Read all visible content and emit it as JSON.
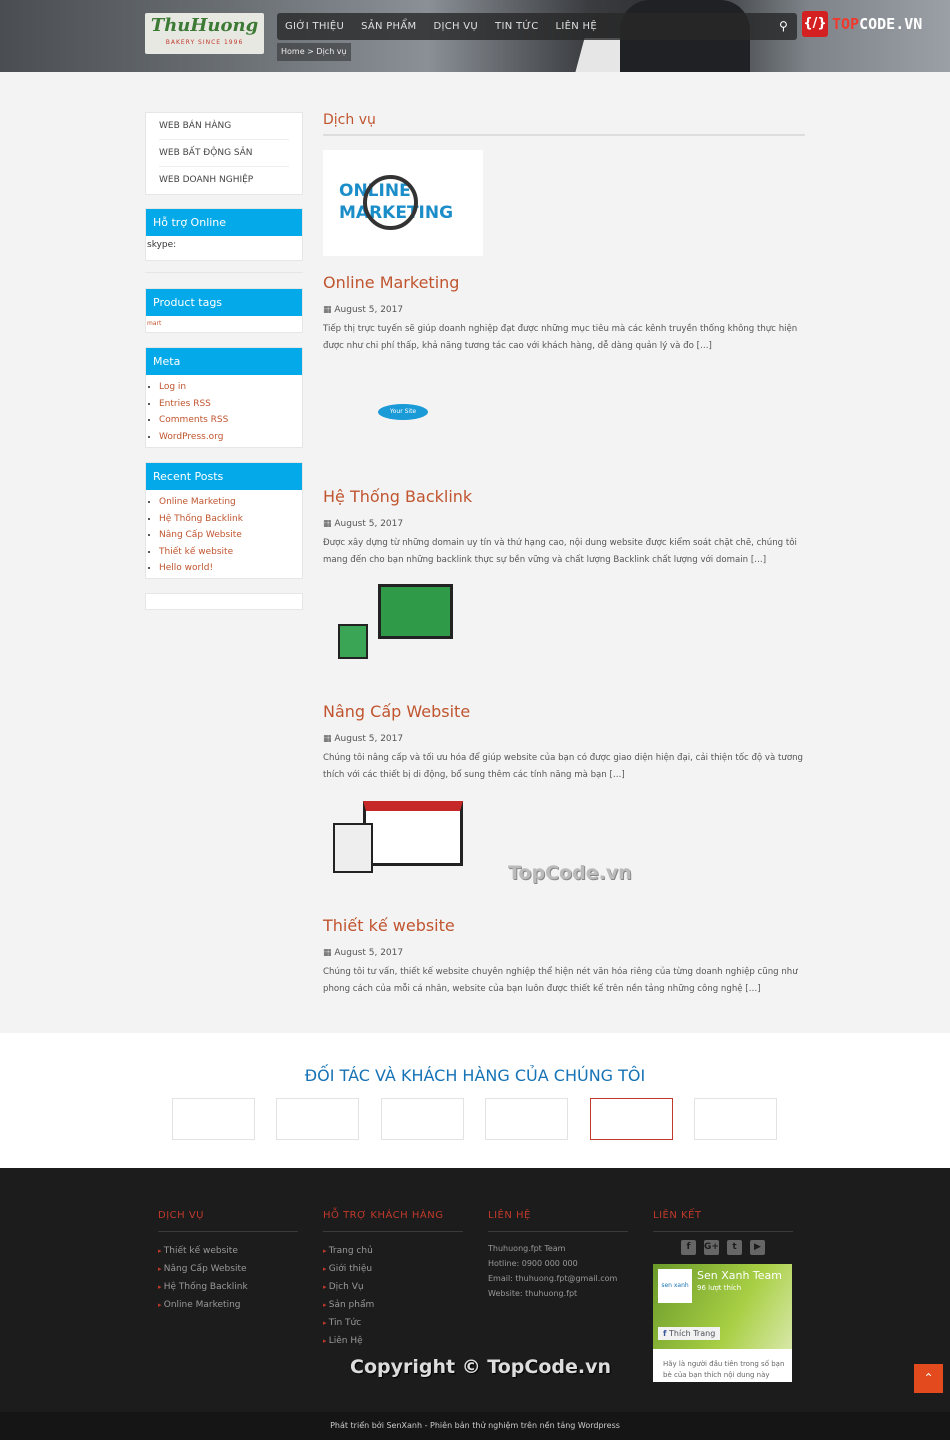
{
  "header": {
    "logo_text": "ThuHuong",
    "logo_sub": "BAKERY SINCE 1996",
    "nav": [
      "GIỚI THIỆU",
      "SẢN PHẨM",
      "DỊCH VỤ",
      "TIN TỨC",
      "LIÊN HỆ"
    ],
    "breadcrumb": "Home > Dịch vụ",
    "brand_prefix": "TOP",
    "brand_suffix": "CODE.VN"
  },
  "sidebar": {
    "categories": [
      "WEB BÁN HÀNG",
      "WEB BẤT ĐỘNG SẢN",
      "WEB DOANH NGHIỆP"
    ],
    "support": {
      "title": "Hỗ trợ Online",
      "skype": "skype:"
    },
    "tags": {
      "title": "Product tags",
      "items": [
        "mart"
      ]
    },
    "meta": {
      "title": "Meta",
      "items": [
        "Log in",
        "Entries RSS",
        "Comments RSS",
        "WordPress.org"
      ]
    },
    "recent": {
      "title": "Recent Posts",
      "items": [
        "Online Marketing",
        "Hệ Thống Backlink",
        "Nâng Cấp Website",
        "Thiết kế website",
        "Hello world!"
      ]
    }
  },
  "main": {
    "title": "Dịch vụ",
    "posts": [
      {
        "title": "Online Marketing",
        "date": "August 5, 2017",
        "excerpt": "Tiếp thị trực tuyến sẽ giúp doanh nghiệp đạt được những mục tiêu mà các kênh truyền thống không thực hiện được như chi phí thấp, khả năng tương tác cao với khách hàng, dễ dàng quản lý và đo […]",
        "image_text": "ONLINE MARKETING"
      },
      {
        "title": "Hệ Thống Backlink",
        "date": "August 5, 2017",
        "excerpt": "Được xây dựng từ những domain uy tín và thứ hạng cao, nội dung website được kiểm soát chặt chẽ, chúng tôi mang đến cho bạn những backlink thực sự bền vững và chất lượng Backlink chất lượng với domain […]",
        "image_text": "Your Site"
      },
      {
        "title": "Nâng Cấp Website",
        "date": "August 5, 2017",
        "excerpt": "Chúng tôi nâng cấp và tối ưu hóa để giúp website của bạn có được giao diện hiện đại, cải thiện tốc độ và tương thích với các thiết bị di động, bổ sung thêm các tính năng mà bạn […]"
      },
      {
        "title": "Thiết kế website",
        "date": "August 5, 2017",
        "excerpt": "Chúng tôi tư vấn, thiết kế website chuyên nghiệp thể hiện nét văn hóa riêng của từng doanh nghiệp cũng như phong cách của mỗi cá nhân, website của bạn luôn được thiết kế trên nền tảng những công nghệ […]"
      }
    ],
    "watermark": "TopCode.vn"
  },
  "partners": {
    "title": "ĐỐI TÁC VÀ KHÁCH HÀNG CỦA CHÚNG TÔI"
  },
  "footer": {
    "services": {
      "title": "DỊCH VỤ",
      "items": [
        "Thiết kế website",
        "Nâng Cấp Website",
        "Hệ Thống Backlink",
        "Online Marketing"
      ]
    },
    "support": {
      "title": "HỖ TRỢ KHÁCH HÀNG",
      "items": [
        "Trang chủ",
        "Giới thiệu",
        "Dịch Vụ",
        "Sản phẩm",
        "Tin Tức",
        "Liên Hệ"
      ]
    },
    "contact": {
      "title": "LIÊN HỆ",
      "lines": [
        "Thuhuong.fpt Team",
        "Hotline: 0900 000 000",
        "Email: thuhuong.fpt@gmail.com",
        "Website: thuhuong.fpt"
      ]
    },
    "links": {
      "title": "LIÊN KẾT",
      "social": [
        "facebook",
        "google-plus",
        "twitter",
        "youtube"
      ],
      "fb_page": "Sen Xanh Team",
      "fb_likes": "96 lượt thích",
      "fb_like_btn": "Thích Trang",
      "fb_note": "Hãy là người đầu tiên trong số bạn bè của bạn thích nội dung này"
    },
    "copyright": "Copyright © TopCode.vn",
    "bottom": "Phát triển bởi SenXanh - Phiên bản thử nghiệm trên nền tảng Wordpress"
  },
  "colors": {
    "accent": "#c0552f",
    "widget_header": "#03a9e8",
    "footer_bg": "#1c1c1c"
  }
}
